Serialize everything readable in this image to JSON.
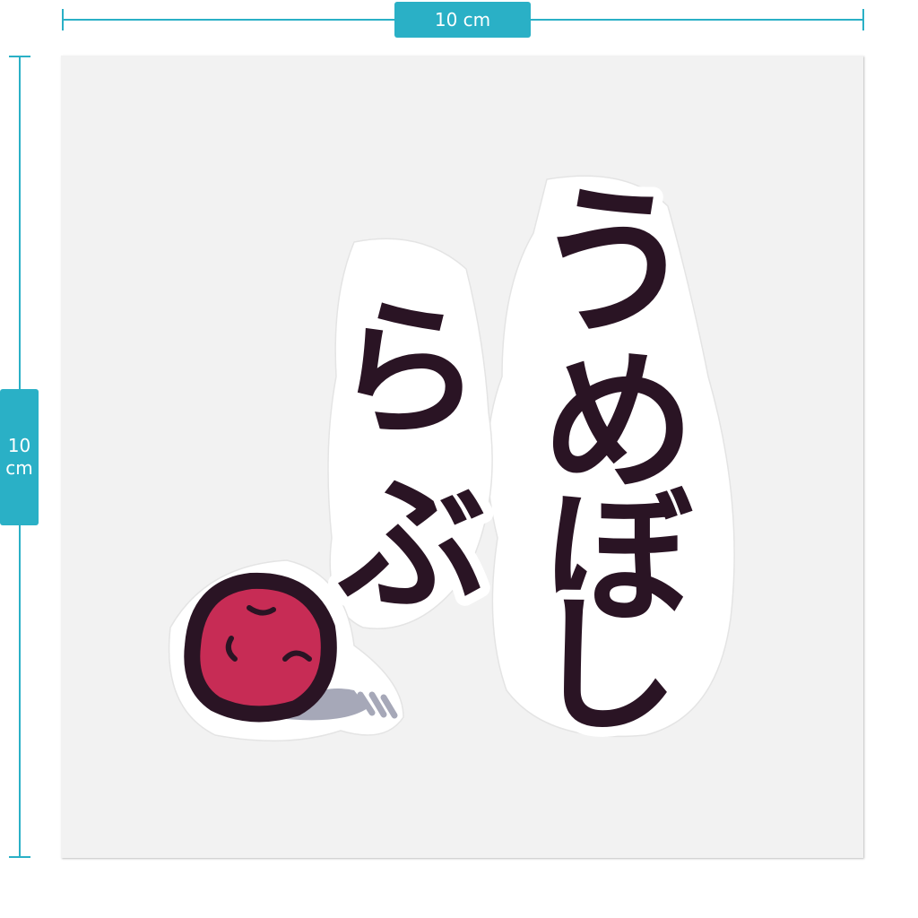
{
  "dimensions": {
    "width_label": "10 cm",
    "height_label_line1": "10",
    "height_label_line2": "cm",
    "accent_color": "#2ab0c6"
  },
  "sticker": {
    "text_column_right": [
      "う",
      "め",
      "ぼ",
      "し"
    ],
    "text_column_left": [
      "ら",
      "ぶ"
    ],
    "text_color": "#2a1424",
    "character": "umeboshi-plum-icon",
    "plum_color": "#c72c55",
    "background_color": "#f2f2f2"
  }
}
